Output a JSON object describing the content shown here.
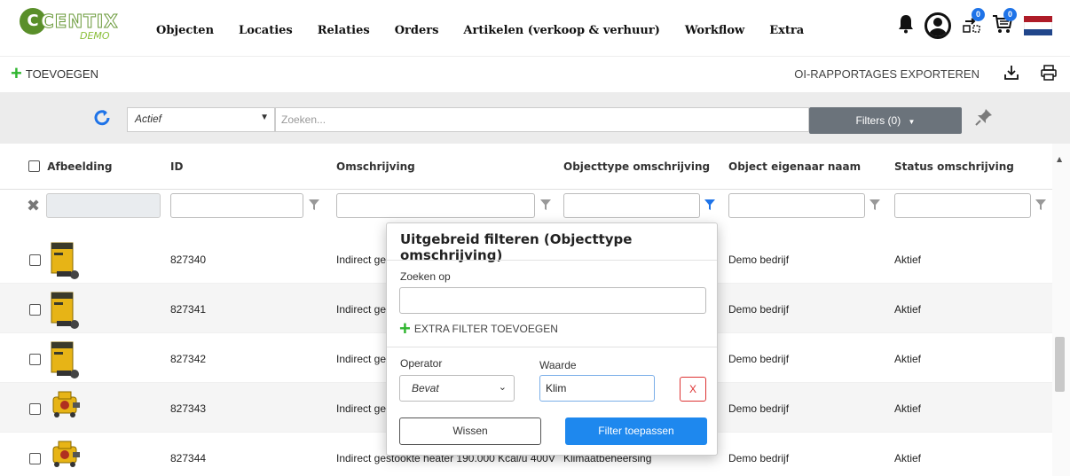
{
  "header": {
    "logo_text": "CENTIX",
    "logo_demo": "DEMO",
    "nav": [
      "Objecten",
      "Locaties",
      "Relaties",
      "Orders",
      "Artikelen (verkoop & verhuur)",
      "Workflow",
      "Extra"
    ],
    "badges": {
      "notifications": "0",
      "cart": "0"
    },
    "flag_colors": [
      "#ae1c28",
      "#ffffff",
      "#21468b"
    ]
  },
  "toolbar": {
    "add_label": "TOEVOEGEN",
    "export_label": "OI-RAPPORTAGES EXPORTEREN"
  },
  "filterbar": {
    "status_value": "Actief",
    "search_placeholder": "Zoeken...",
    "filters_label": "Filters (0)"
  },
  "table": {
    "columns": [
      "Afbeelding",
      "ID",
      "Omschrijving",
      "Objecttype omschrijving",
      "Object eigenaar naam",
      "Status omschrijving"
    ],
    "rows": [
      {
        "id": "827340",
        "omschrijving": "Indirect ges",
        "type": "",
        "eigenaar": "Demo bedrijf",
        "status": "Aktief",
        "img": "dryer-icon"
      },
      {
        "id": "827341",
        "omschrijving": "Indirect ges",
        "type": "",
        "eigenaar": "Demo bedrijf",
        "status": "Aktief",
        "img": "dryer-icon"
      },
      {
        "id": "827342",
        "omschrijving": "Indirect ges",
        "type": "",
        "eigenaar": "Demo bedrijf",
        "status": "Aktief",
        "img": "dryer-icon"
      },
      {
        "id": "827343",
        "omschrijving": "Indirect ges",
        "type": "",
        "eigenaar": "Demo bedrijf",
        "status": "Aktief",
        "img": "heater-icon"
      },
      {
        "id": "827344",
        "omschrijving": "Indirect gestookte heater 190.000 Kcal/u 400V",
        "type": "Klimaatbeheersing",
        "eigenaar": "Demo bedrijf",
        "status": "Aktief",
        "img": "heater-icon"
      }
    ]
  },
  "popup": {
    "title": "Uitgebreid filteren (Objecttype omschrijving)",
    "search_label": "Zoeken op",
    "search_value": "",
    "extra_filter_label": "EXTRA FILTER TOEVOEGEN",
    "operator_label": "Operator",
    "operator_value": "Bevat",
    "value_label": "Waarde",
    "value": "Klim",
    "remove_label": "X",
    "clear_label": "Wissen",
    "apply_label": "Filter toepassen"
  }
}
